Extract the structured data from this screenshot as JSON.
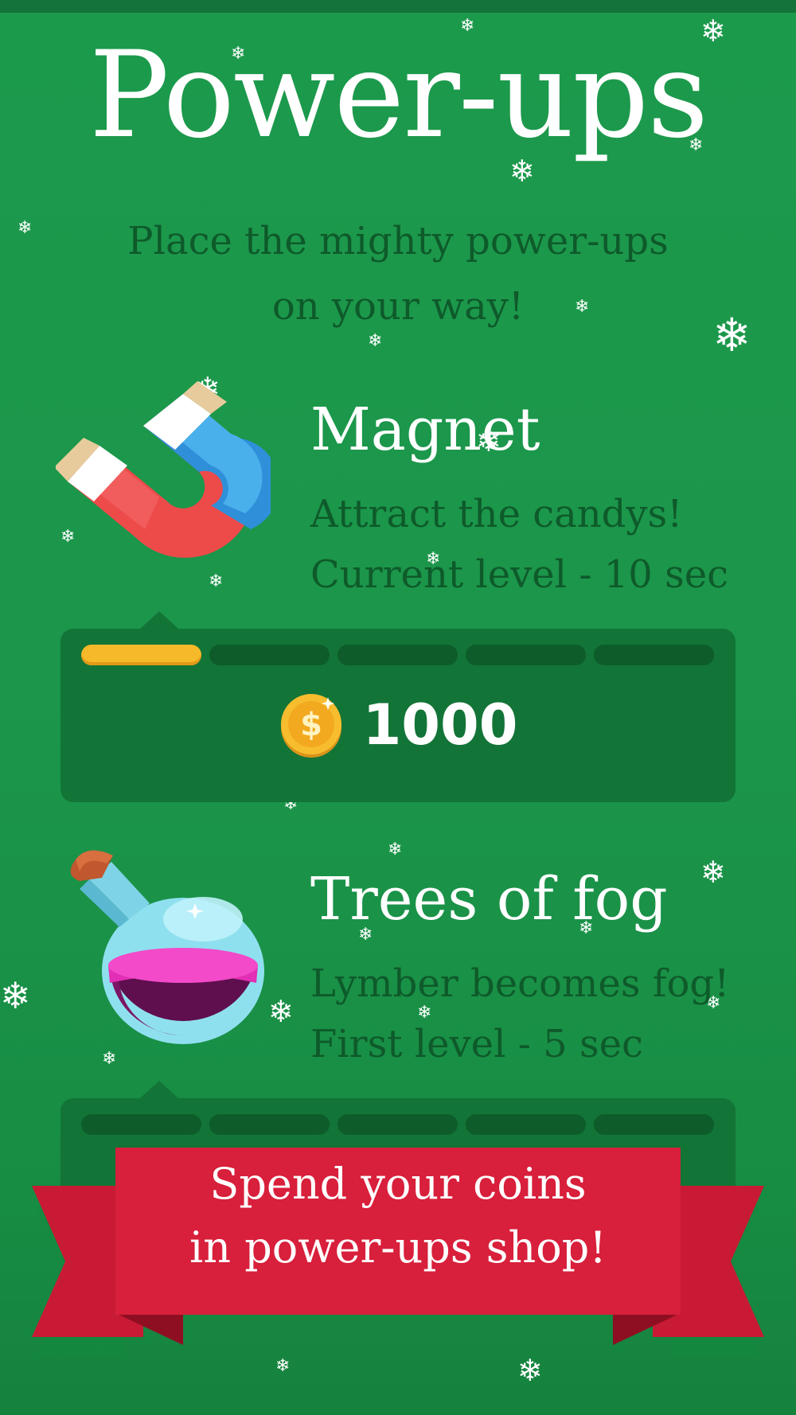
{
  "title": "Power-ups",
  "subtitle": [
    "Place the mighty power-ups",
    "on your way!"
  ],
  "powerups": [
    {
      "name": "Magnet",
      "description": "Attract the candys!",
      "level_text": "Current level - 10 sec",
      "icon": "magnet-icon",
      "level_filled": 1,
      "level_total": 5,
      "price": "1000"
    },
    {
      "name": "Trees of fog",
      "description": "Lymber becomes fog!",
      "level_text": "First level - 5 sec",
      "icon": "potion-icon",
      "level_filled": 0,
      "level_total": 5
    }
  ],
  "banner": {
    "lines": [
      "Spend your coins",
      "in power-ups shop!"
    ]
  },
  "colors": {
    "background": "#1b954a",
    "panel": "#137437",
    "level_on": "#f6b92a",
    "level_off": "#0d5c2a",
    "banner": "#d81f3b",
    "dark_text": "#0e5a2a"
  }
}
